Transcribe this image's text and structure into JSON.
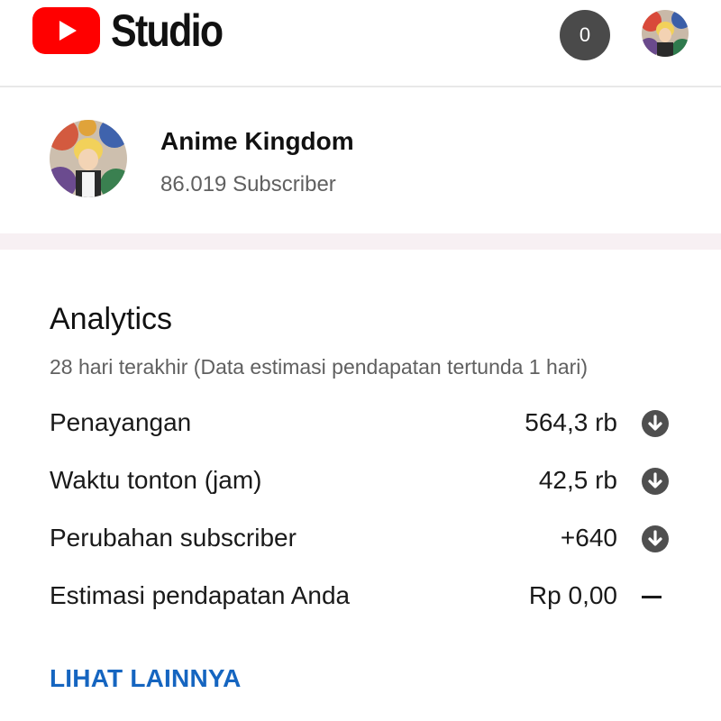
{
  "header": {
    "brand_label": "Studio",
    "notification_count": "0",
    "logo_icon": "youtube-play-icon",
    "brand_color": "#ff0000"
  },
  "channel": {
    "name": "Anime Kingdom",
    "subscribers": "86.019 Subscriber"
  },
  "analytics": {
    "title": "Analytics",
    "subtitle": "28 hari terakhir (Data estimasi pendapatan tertunda 1 hari)",
    "rows": [
      {
        "label": "Penayangan",
        "value": "564,3 rb",
        "trend": "down-arrow-icon"
      },
      {
        "label": "Waktu tonton (jam)",
        "value": "42,5 rb",
        "trend": "down-arrow-icon"
      },
      {
        "label": "Perubahan subscriber",
        "value": "+640",
        "trend": "down-arrow-icon"
      },
      {
        "label": "Estimasi pendapatan Anda",
        "value": "Rp 0,00",
        "trend": "dash-icon"
      }
    ],
    "more_label": "LIHAT LAINNYA",
    "link_color": "#1565c0"
  }
}
